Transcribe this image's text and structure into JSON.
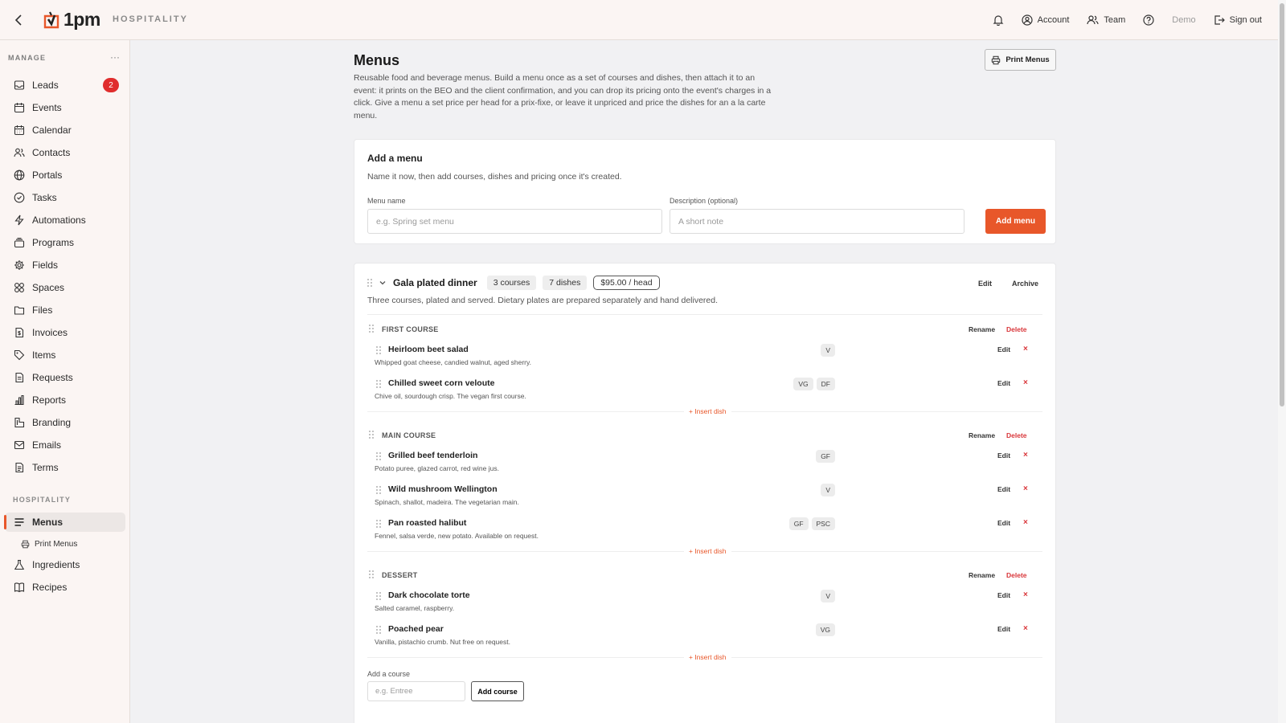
{
  "app": {
    "brand": "1pm",
    "section": "HOSPITALITY"
  },
  "topbar": {
    "account": "Account",
    "team": "Team",
    "demo": "Demo",
    "sign_out": "Sign out"
  },
  "sidebar": {
    "manage_header": "MANAGE",
    "more": "···",
    "leads_badge": "2",
    "items": [
      "Leads",
      "Events",
      "Calendar",
      "Contacts",
      "Portals",
      "Tasks",
      "Automations",
      "Programs",
      "Fields",
      "Spaces",
      "Files",
      "Invoices",
      "Items",
      "Requests",
      "Reports",
      "Branding",
      "Emails",
      "Terms"
    ],
    "hospitality_header": "HOSPITALITY",
    "hosp_items": [
      "Menus",
      "Print Menus",
      "Ingredients",
      "Recipes"
    ]
  },
  "page": {
    "title": "Menus",
    "description": "Reusable food and beverage menus. Build a menu once as a set of courses and dishes, then attach it to an event: it prints on the BEO and the client confirmation, and you can drop its pricing onto the event's charges in a click. Give a menu a set price per head for a prix-fixe, or leave it unpriced and price the dishes for an a la carte menu.",
    "print_button": "Print Menus"
  },
  "add_menu": {
    "title": "Add a menu",
    "subtitle": "Name it now, then add courses, dishes and pricing once it's created.",
    "name_label": "Menu name",
    "name_placeholder": "e.g. Spring set menu",
    "desc_label": "Description (optional)",
    "desc_placeholder": "A short note",
    "button": "Add menu"
  },
  "menu": {
    "name": "Gala plated dinner",
    "courses_pill": "3 courses",
    "dishes_pill": "7 dishes",
    "price_pill": "$95.00 / head",
    "edit": "Edit",
    "archive": "Archive",
    "description": "Three courses, plated and served. Dietary plates are prepared separately and hand delivered.",
    "rename": "Rename",
    "delete": "Delete",
    "dish_edit": "Edit",
    "dish_remove": "×",
    "insert_dish": "+ Insert dish",
    "courses": [
      {
        "name": "FIRST COURSE",
        "dishes": [
          {
            "name": "Heirloom beet salad",
            "desc": "Whipped goat cheese, candied walnut, aged sherry.",
            "tags": [
              "V"
            ]
          },
          {
            "name": "Chilled sweet corn veloute",
            "desc": "Chive oil, sourdough crisp. The vegan first course.",
            "tags": [
              "VG",
              "DF"
            ]
          }
        ]
      },
      {
        "name": "MAIN COURSE",
        "dishes": [
          {
            "name": "Grilled beef tenderloin",
            "desc": "Potato puree, glazed carrot, red wine jus.",
            "tags": [
              "GF"
            ]
          },
          {
            "name": "Wild mushroom Wellington",
            "desc": "Spinach, shallot, madeira. The vegetarian main.",
            "tags": [
              "V"
            ]
          },
          {
            "name": "Pan roasted halibut",
            "desc": "Fennel, salsa verde, new potato. Available on request.",
            "tags": [
              "GF",
              "PSC"
            ]
          }
        ]
      },
      {
        "name": "DESSERT",
        "dishes": [
          {
            "name": "Dark chocolate torte",
            "desc": "Salted caramel, raspberry.",
            "tags": [
              "V"
            ]
          },
          {
            "name": "Poached pear",
            "desc": "Vanilla, pistachio crumb. Nut free on request.",
            "tags": [
              "VG"
            ]
          }
        ]
      }
    ],
    "add_course_label": "Add a course",
    "add_course_placeholder": "e.g. Entree",
    "add_course_button": "Add course"
  },
  "colors": {
    "accent": "#e8572a",
    "danger": "#d9363a",
    "badge": "#e02d2d"
  }
}
